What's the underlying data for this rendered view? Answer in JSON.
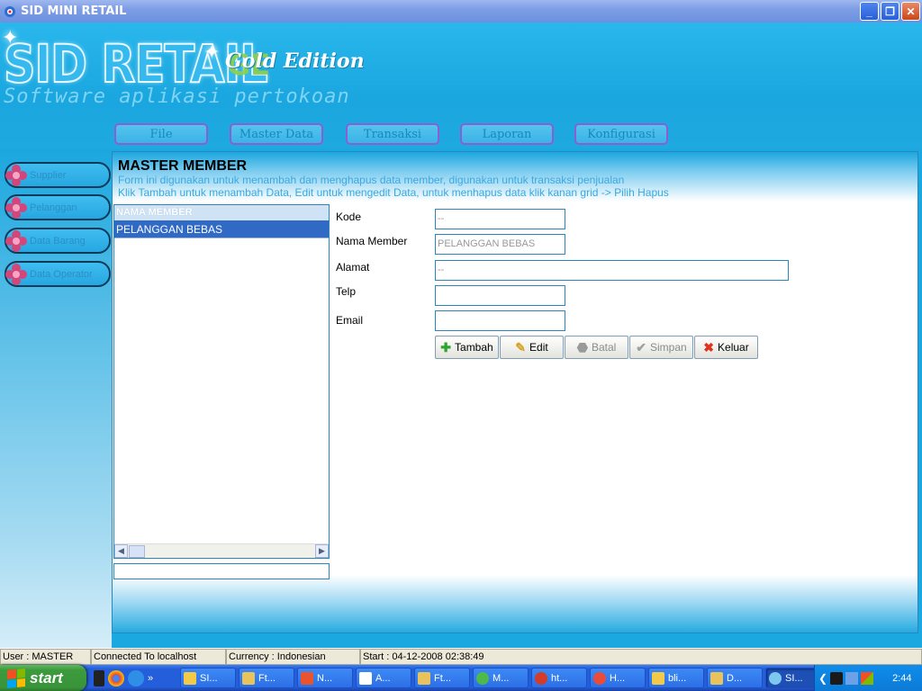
{
  "window": {
    "title": "SID MINI RETAIL"
  },
  "header": {
    "logo": "SID RETAIL",
    "edition_mark": "GE",
    "edition": "Gold Edition",
    "tagline": "Software aplikasi pertokoan"
  },
  "menu": [
    {
      "label": "File"
    },
    {
      "label": "Master Data"
    },
    {
      "label": "Transaksi"
    },
    {
      "label": "Laporan"
    },
    {
      "label": "Konfigurasi"
    }
  ],
  "sidebar": [
    {
      "label": "Supplier"
    },
    {
      "label": "Pelanggan"
    },
    {
      "label": "Data Barang"
    },
    {
      "label": "Data Operator"
    }
  ],
  "main": {
    "title": "MASTER MEMBER",
    "desc1": "Form ini digunakan untuk menambah dan menghapus data member, digunakan untuk transaksi penjualan",
    "desc2": "Klik Tambah untuk menambah Data, Edit untuk mengedit Data, untuk menhapus data klik kanan grid -> Pilih Hapus",
    "grid": {
      "column": "NAMA MEMBER",
      "rows": [
        "PELANGGAN BEBAS"
      ],
      "search_value": ""
    },
    "form": {
      "kode_label": "Kode",
      "kode_value": "--",
      "nama_label": "Nama Member",
      "nama_value": "PELANGGAN BEBAS",
      "alamat_label": "Alamat",
      "alamat_value": "--",
      "telp_label": "Telp",
      "telp_value": "",
      "email_label": "Email",
      "email_value": ""
    },
    "buttons": {
      "tambah": "Tambah",
      "edit": "Edit",
      "batal": "Batal",
      "simpan": "Simpan",
      "keluar": "Keluar"
    }
  },
  "status": {
    "user": "User : MASTER",
    "connection": "Connected To localhost",
    "currency": "Currency : Indonesian",
    "start": "Start  : 04-12-2008 02:38:49"
  },
  "taskbar": {
    "start": "start",
    "chevron": "»",
    "tasks": [
      {
        "label": "SI...",
        "color": "#f3c94a"
      },
      {
        "label": "Ft...",
        "color": "#e8c25a"
      },
      {
        "label": "N...",
        "color": "#e9532e"
      },
      {
        "label": "A...",
        "color": "#ffffff"
      },
      {
        "label": "Ft...",
        "color": "#e8c25a"
      },
      {
        "label": "M...",
        "color": "#4fb94a"
      },
      {
        "label": "ht...",
        "color": "#d33c28"
      },
      {
        "label": "H...",
        "color": "#ea4c3a"
      },
      {
        "label": "bli...",
        "color": "#f3c94a"
      },
      {
        "label": "D...",
        "color": "#e8c25a"
      },
      {
        "label": "SI...",
        "color": "#7ec8f0"
      }
    ],
    "clock": "2:44"
  },
  "colors": {
    "accent": "#1ba7df",
    "selection": "#316ac5"
  }
}
